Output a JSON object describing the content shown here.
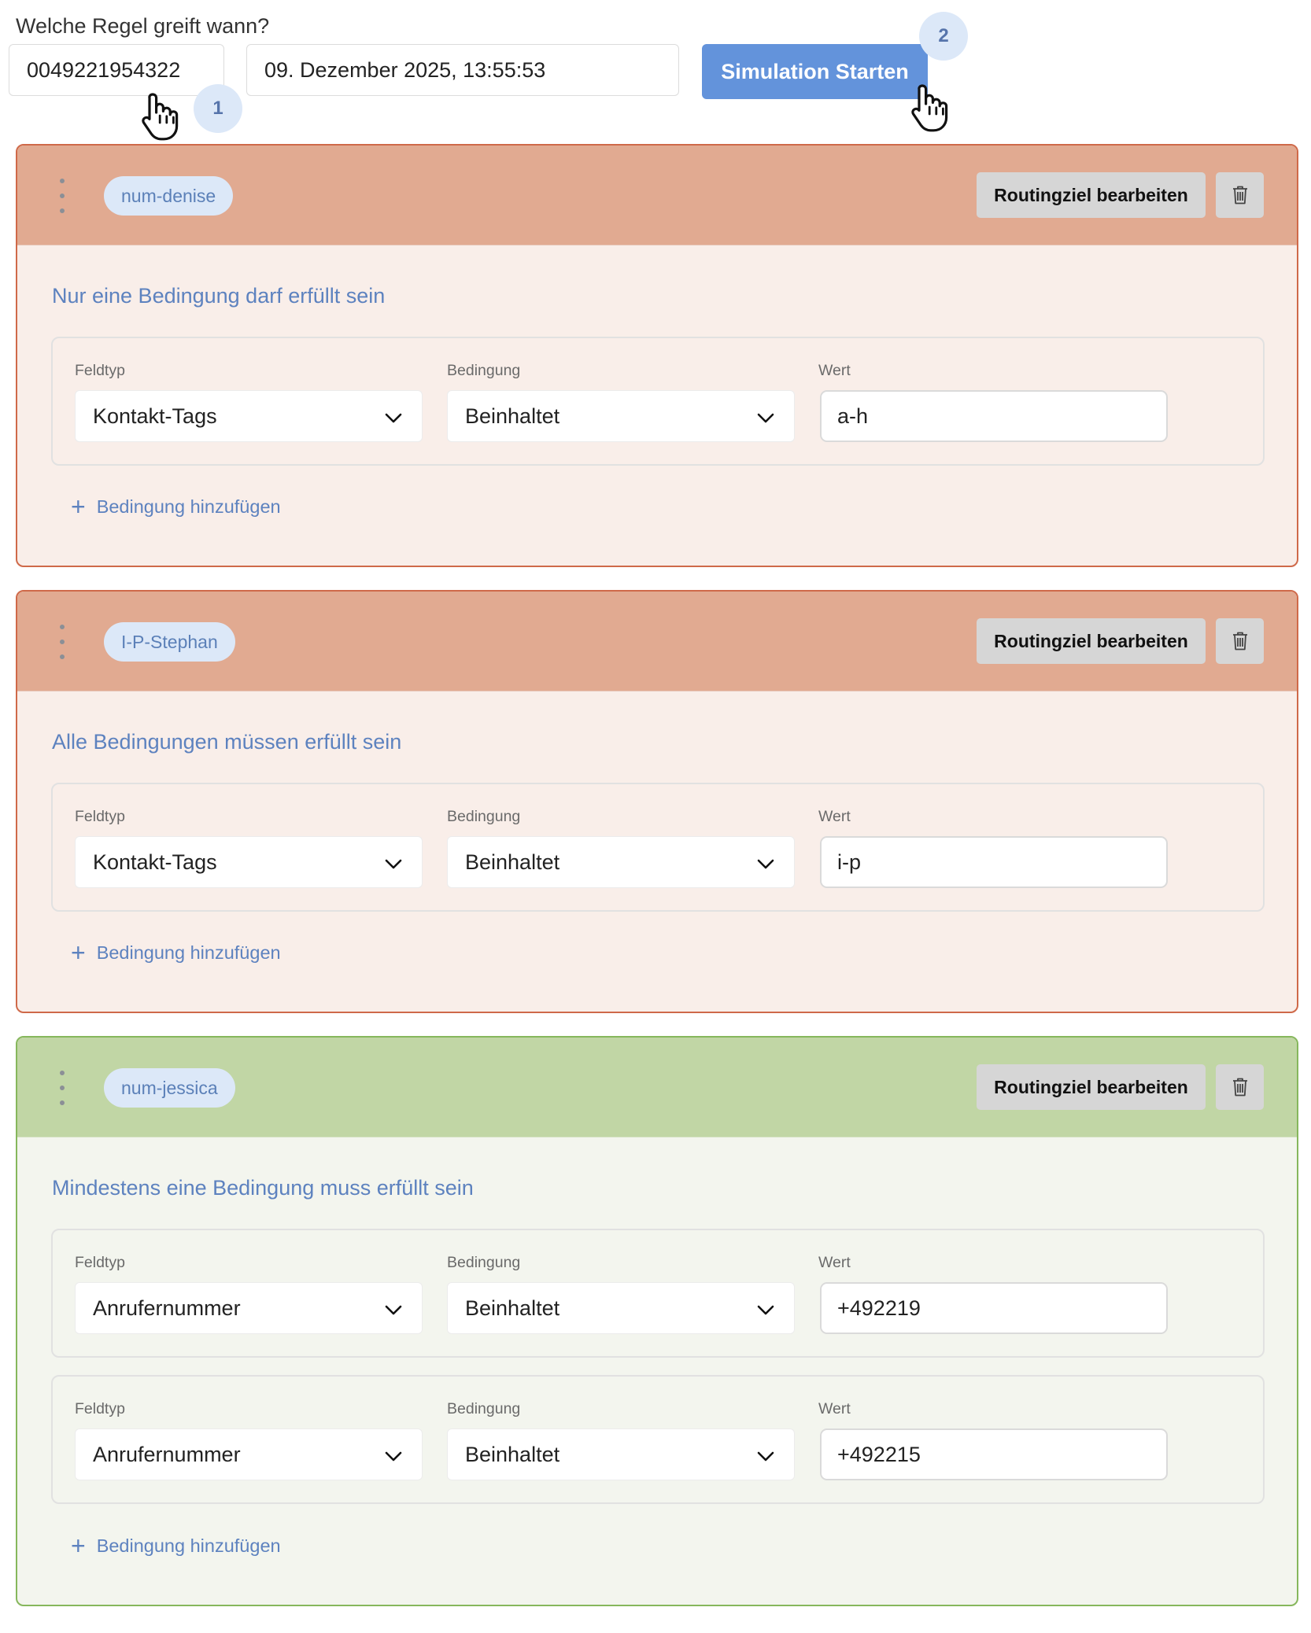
{
  "simulation": {
    "label": "Welche Regel greift wann?",
    "phone": "0049221954322",
    "datetime": "09. Dezember 2025, 13:55:53",
    "button_label": "Simulation Starten",
    "step1": "1",
    "step2": "2"
  },
  "common": {
    "edit_label": "Routingziel bearbeiten",
    "add_condition_label": "Bedingung hinzufügen",
    "field_label": "Feldtyp",
    "condition_label": "Bedingung",
    "value_label": "Wert"
  },
  "rules": [
    {
      "target": "num-denise",
      "mode": "Nur eine Bedingung darf erfüllt sein",
      "status": "red",
      "conditions": [
        {
          "field": "Kontakt-Tags",
          "operator": "Beinhaltet",
          "value": "a-h"
        }
      ]
    },
    {
      "target": "I-P-Stephan",
      "mode": "Alle Bedingungen müssen erfüllt sein",
      "status": "red",
      "conditions": [
        {
          "field": "Kontakt-Tags",
          "operator": "Beinhaltet",
          "value": "i-p"
        }
      ]
    },
    {
      "target": "num-jessica",
      "mode": "Mindestens eine Bedingung muss erfüllt sein",
      "status": "green",
      "conditions": [
        {
          "field": "Anrufernummer",
          "operator": "Beinhaltet",
          "value": "+492219"
        },
        {
          "field": "Anrufernummer",
          "operator": "Beinhaltet",
          "value": "+492215"
        }
      ]
    }
  ],
  "colors": {
    "accent": "#6393db",
    "chip_bg": "#dce8f8",
    "mismatch_header": "#e1aa91",
    "mismatch_border": "#cf6949",
    "match_header": "#c1d6a5",
    "match_border": "#86b75c"
  },
  "icons": [
    "hand-pointer-icon",
    "drag-handle-icon",
    "trash-icon",
    "chevron-down-icon",
    "plus-icon"
  ]
}
